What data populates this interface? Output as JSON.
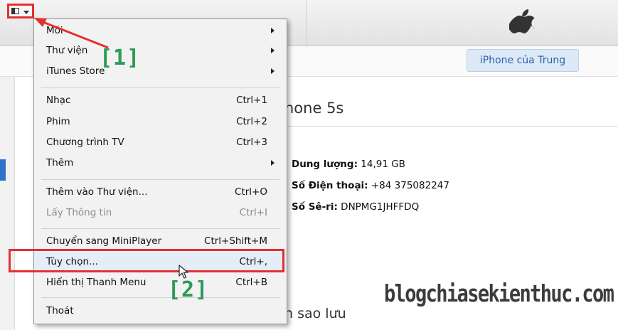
{
  "menu": {
    "items": [
      {
        "label": "Mới",
        "shortcut": "",
        "submenu": true
      },
      {
        "label": "Thư viện",
        "shortcut": "",
        "submenu": true
      },
      {
        "label": "iTunes Store",
        "shortcut": "",
        "submenu": true
      },
      {
        "label": "Nhạc",
        "shortcut": "Ctrl+1",
        "submenu": false
      },
      {
        "label": "Phim",
        "shortcut": "Ctrl+2",
        "submenu": false
      },
      {
        "label": "Chương trình TV",
        "shortcut": "Ctrl+3",
        "submenu": false
      },
      {
        "label": "Thêm",
        "shortcut": "",
        "submenu": true
      },
      {
        "label": "Thêm vào Thư viện...",
        "shortcut": "Ctrl+O",
        "submenu": false
      },
      {
        "label": "Lấy Thông tin",
        "shortcut": "Ctrl+I",
        "submenu": false,
        "disabled": true
      },
      {
        "label": "Chuyển sang MiniPlayer",
        "shortcut": "Ctrl+Shift+M",
        "submenu": false
      },
      {
        "label": "Tùy chọn...",
        "shortcut": "Ctrl+,",
        "submenu": false,
        "highlighted": true
      },
      {
        "label": "Hiển thị Thanh Menu",
        "shortcut": "Ctrl+B",
        "submenu": false
      },
      {
        "label": "Thoát",
        "shortcut": "",
        "submenu": false
      }
    ]
  },
  "header": {
    "device_button_label": "iPhone của Trung"
  },
  "device": {
    "title": "hone 5s",
    "capacity_label": "Dung lượng:",
    "capacity_value": "14,91 GB",
    "phone_label": "Số Điện thoại:",
    "phone_value": "+84 375082247",
    "serial_label": "Số Sê-ri:",
    "serial_value": "DNPMG1JHFFDQ"
  },
  "backup": {
    "title": "n sao lưu"
  },
  "annotations": {
    "step1": "[1]",
    "step2": "[2]",
    "color": "#e33030",
    "label_color": "#2e9a57"
  },
  "watermark": "blogchiasekienthuc.com",
  "colors": {
    "accent_blue": "#2f73c8",
    "device_button_text": "#2a62a8",
    "highlight_red": "#e33030"
  }
}
